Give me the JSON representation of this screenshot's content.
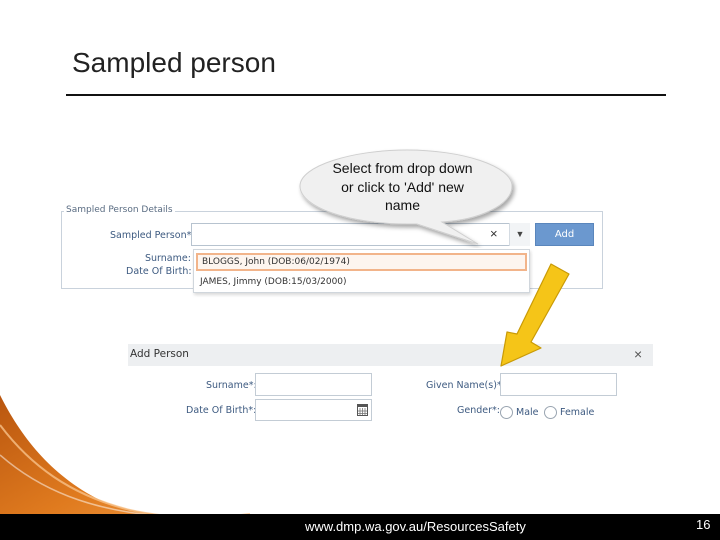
{
  "slide": {
    "title": "Sampled person",
    "footer_url": "www.dmp.wa.gov.au/ResourcesSafety",
    "page_number": "16"
  },
  "callout": {
    "text": "Select from drop down or click to 'Add' new name"
  },
  "sampled_person_panel": {
    "legend": "Sampled Person Details",
    "sampled_person_label": "Sampled Person*:",
    "surname_label": "Surname:",
    "dob_label": "Date Of Birth:",
    "clear_glyph": "×",
    "dropdown_arrow_glyph": "▼",
    "add_button_label": "Add",
    "dropdown_options": [
      "BLOGGS, John (DOB:06/02/1974)",
      "JAMES, Jimmy (DOB:15/03/2000)"
    ],
    "selected_option": "BLOGGS, John (DOB:06/02/1974)"
  },
  "add_person_window": {
    "title": "Add Person",
    "close_glyph": "×",
    "surname_label": "Surname*:",
    "given_names_label": "Given Name(s)*:",
    "dob_label": "Date Of Birth*:",
    "gender_label": "Gender*:",
    "gender_options": [
      "Male",
      "Female"
    ]
  },
  "icons": {
    "calendar": "calendar-icon",
    "arrow": "arrow-down-left-icon"
  },
  "colors": {
    "add_button": "#6b98cf",
    "label_text": "#3d5a80",
    "callout_fill": "#f0f0f0",
    "arrow_fill": "#f5c518",
    "selected_border": "#f2b48a",
    "swoosh": "#e07b1f",
    "footer": "#000000"
  }
}
